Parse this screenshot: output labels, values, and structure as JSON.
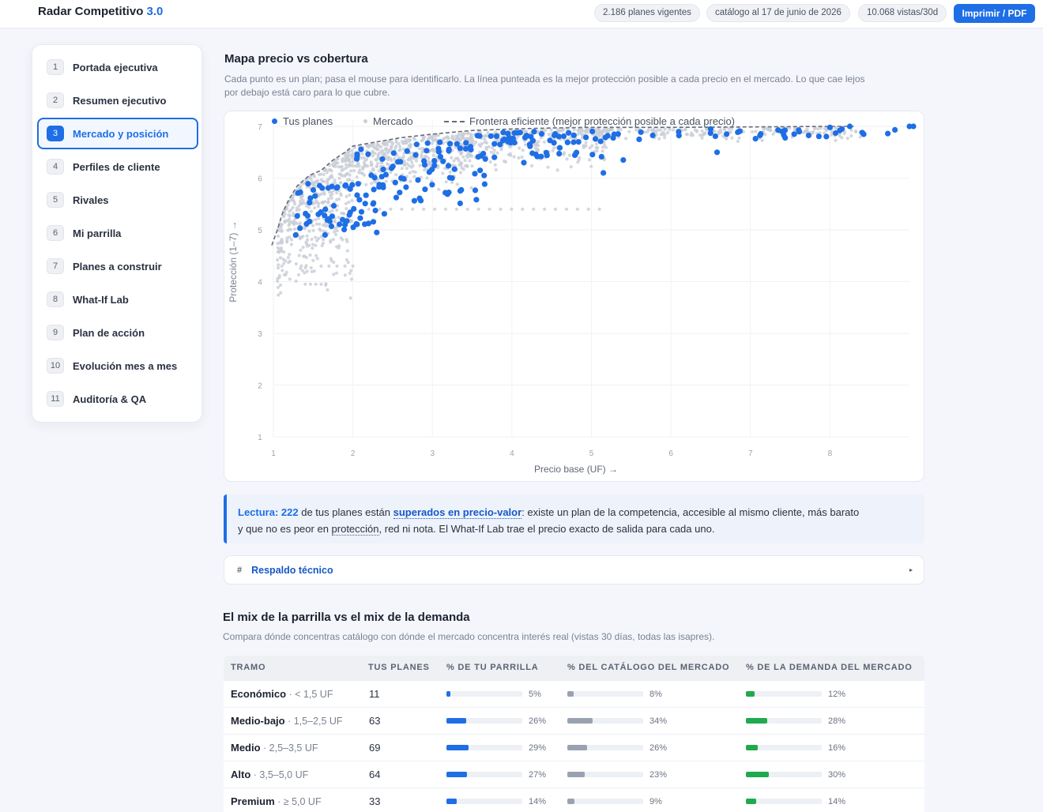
{
  "header": {
    "brand": "Radar Competitivo",
    "version": "3.0",
    "pills": [
      "2.186 planes vigentes",
      "catálogo al 17 de junio de 2026",
      "10.068 vistas/30d"
    ],
    "print_label": "Imprimir / PDF"
  },
  "sidebar": {
    "items": [
      {
        "num": "1",
        "label": "Portada ejecutiva"
      },
      {
        "num": "2",
        "label": "Resumen ejecutivo"
      },
      {
        "num": "3",
        "label": "Mercado y posición"
      },
      {
        "num": "4",
        "label": "Perfiles de cliente"
      },
      {
        "num": "5",
        "label": "Rivales"
      },
      {
        "num": "6",
        "label": "Mi parrilla"
      },
      {
        "num": "7",
        "label": "Planes a construir"
      },
      {
        "num": "8",
        "label": "What-If Lab"
      },
      {
        "num": "9",
        "label": "Plan de acción"
      },
      {
        "num": "10",
        "label": "Evolución mes a mes"
      },
      {
        "num": "11",
        "label": "Auditoría & QA"
      }
    ],
    "active_index": 2
  },
  "map_section": {
    "title": "Mapa precio vs cobertura",
    "subtitle_line1": "Cada punto es un plan; pasa el mouse para identificarlo. La línea punteada es la mejor protección posible a cada precio en el mercado. Lo que cae lejos",
    "subtitle_line2": "por debajo está caro para lo que cubre."
  },
  "chart_data": {
    "type": "scatter",
    "xlabel": "Precio base (UF) →",
    "ylabel": "Protección (1–7) →",
    "xlim": [
      1,
      9
    ],
    "ylim": [
      1,
      7
    ],
    "x_ticks": [
      1,
      2,
      3,
      4,
      5,
      6,
      7,
      8
    ],
    "y_ticks": [
      1,
      2,
      3,
      4,
      5,
      6,
      7
    ],
    "grid": true,
    "legend": [
      "Tus planes",
      "Mercado",
      "Frontera eficiente (mejor protección posible a cada precio)"
    ],
    "legend_position": "top-left",
    "colors": {
      "own": "#1e6ee6",
      "market": "#c8cdd6",
      "frontier": "#666c78"
    },
    "frontier": {
      "x": [
        0.98,
        1.05,
        1.12,
        1.2,
        1.3,
        1.45,
        1.6,
        1.75,
        1.9,
        2.0,
        2.3,
        2.6,
        3.0,
        3.5,
        4.0,
        4.5,
        5.0,
        6.0,
        7.0,
        8.0,
        8.3
      ],
      "y": [
        4.7,
        5.0,
        5.35,
        5.6,
        5.85,
        6.05,
        6.15,
        6.35,
        6.5,
        6.62,
        6.7,
        6.78,
        6.85,
        6.92,
        6.95,
        6.97,
        6.98,
        6.98,
        6.99,
        7.0,
        7.0
      ]
    },
    "market_clusters": [
      {
        "x": [
          1.05,
          2.0
        ],
        "y": [
          3.5,
          6.55
        ],
        "n": 420
      },
      {
        "x": [
          1.9,
          3.5
        ],
        "y": [
          5.6,
          6.85
        ],
        "n": 420
      },
      {
        "x": [
          3.3,
          5.2
        ],
        "y": [
          6.1,
          6.98
        ],
        "n": 320
      },
      {
        "x": [
          5.0,
          8.4
        ],
        "y": [
          6.7,
          7.0
        ],
        "n": 200
      }
    ],
    "market_rows": [
      {
        "x_from": 2.2,
        "x_to": 5.1,
        "y": 5.4,
        "n": 22
      },
      {
        "x_from": 1.6,
        "x_to": 2.0,
        "y": 4.3,
        "n": 5
      },
      {
        "x_from": 1.4,
        "x_to": 1.6,
        "y": 3.95,
        "n": 4
      }
    ],
    "own_clusters": [
      {
        "x": [
          1.3,
          2.4
        ],
        "y": [
          5.0,
          5.9
        ],
        "n": 60
      },
      {
        "x": [
          2.0,
          3.7
        ],
        "y": [
          5.5,
          6.7
        ],
        "n": 70
      },
      {
        "x": [
          3.4,
          5.2
        ],
        "y": [
          6.4,
          7.0
        ],
        "n": 60
      },
      {
        "x": [
          5.2,
          8.9
        ],
        "y": [
          6.75,
          7.0
        ],
        "n": 30
      }
    ],
    "own_points": [
      {
        "x": 1.9,
        "y": 5.1
      },
      {
        "x": 2.3,
        "y": 4.95
      },
      {
        "x": 1.65,
        "y": 4.9
      },
      {
        "x": 1.28,
        "y": 4.9
      },
      {
        "x": 3.6,
        "y": 6.15
      },
      {
        "x": 3.65,
        "y": 6.05
      },
      {
        "x": 4.15,
        "y": 6.3
      },
      {
        "x": 5.15,
        "y": 6.1
      },
      {
        "x": 5.4,
        "y": 6.35
      },
      {
        "x": 6.58,
        "y": 6.5
      },
      {
        "x": 5.6,
        "y": 6.75
      },
      {
        "x": 8.0,
        "y": 6.98
      },
      {
        "x": 8.15,
        "y": 6.95
      },
      {
        "x": 8.25,
        "y": 7.0
      },
      {
        "x": 9.0,
        "y": 7.0
      },
      {
        "x": 9.05,
        "y": 7.0
      },
      {
        "x": 7.4,
        "y": 6.9
      },
      {
        "x": 7.55,
        "y": 6.85
      },
      {
        "x": 6.5,
        "y": 6.95
      },
      {
        "x": 6.7,
        "y": 6.85
      }
    ]
  },
  "callout": {
    "lead": "Lectura:",
    "count": "222",
    "t1": " de tus planes están ",
    "link": "superados en precio-valor",
    "t2": ": existe un plan de la competencia, accesible al mismo cliente, más barato",
    "t3": "y que no es peor en ",
    "dotted": "protección",
    "t4": ", red ni nota. El What-If Lab trae el precio exacto de salida para cada uno."
  },
  "details": {
    "hash": "#",
    "label": "Respaldo técnico",
    "caret": "▸"
  },
  "mix_section": {
    "title": "El mix de la parrilla vs el mix de la demanda",
    "subtitle": "Compara dónde concentras catálogo con dónde el mercado concentra interés real (vistas 30 días, todas las isapres).",
    "columns": [
      "TRAMO",
      "TUS PLANES",
      "% DE TU PARRILLA",
      "% DEL CATÁLOGO DEL MERCADO",
      "% DE LA DEMANDA DEL MERCADO"
    ],
    "colors": {
      "parrilla": "#1e6ee6",
      "catalogo": "#9aa2b1",
      "demanda": "#1faa4e"
    },
    "rows": [
      {
        "tramo": "Económico",
        "range": " · < 1,5 UF",
        "count": "11",
        "parrilla": 5,
        "parrilla_label": "5%",
        "catalogo": 8,
        "catalogo_label": "8%",
        "demanda": 12,
        "demanda_label": "12%"
      },
      {
        "tramo": "Medio-bajo",
        "range": " · 1,5–2,5 UF",
        "count": "63",
        "parrilla": 26,
        "parrilla_label": "26%",
        "catalogo": 34,
        "catalogo_label": "34%",
        "demanda": 28,
        "demanda_label": "28%"
      },
      {
        "tramo": "Medio",
        "range": " · 2,5–3,5 UF",
        "count": "69",
        "parrilla": 29,
        "parrilla_label": "29%",
        "catalogo": 26,
        "catalogo_label": "26%",
        "demanda": 16,
        "demanda_label": "16%"
      },
      {
        "tramo": "Alto",
        "range": " · 3,5–5,0 UF",
        "count": "64",
        "parrilla": 27,
        "parrilla_label": "27%",
        "catalogo": 23,
        "catalogo_label": "23%",
        "demanda": 30,
        "demanda_label": "30%"
      },
      {
        "tramo": "Premium",
        "range": " · ≥ 5,0 UF",
        "count": "33",
        "parrilla": 14,
        "parrilla_label": "14%",
        "catalogo": 9,
        "catalogo_label": "9%",
        "demanda": 14,
        "demanda_label": "14%"
      }
    ]
  }
}
